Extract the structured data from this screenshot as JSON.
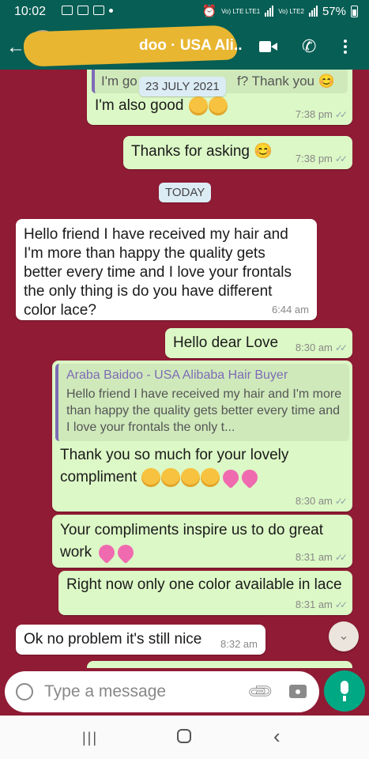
{
  "status_bar": {
    "time": "10:02",
    "lte_label_1": "Vo) LTE LTE1",
    "lte_label_2": "Vo) LTE2",
    "battery": "57%"
  },
  "header": {
    "contact_name_visible": "doo · USA Ali.."
  },
  "chat": {
    "quoted_partial": {
      "text_left": "I'm go",
      "text_right": "f? Thank you 😊"
    },
    "date_overlay": "23 JULY 2021",
    "today_label": "TODAY",
    "messages": [
      {
        "direction": "out",
        "text": "I'm also good",
        "emoji": [
          "🥰",
          "🥰"
        ],
        "time": "7:38 pm"
      },
      {
        "direction": "out",
        "text": "Thanks for asking 😊",
        "time": "7:38 pm"
      },
      {
        "direction": "in",
        "text": "Hello friend I have received my hair and I'm more than happy the quality gets better every time and I love your frontals the only thing is do you have different color lace?",
        "time": "6:44 am"
      },
      {
        "direction": "out",
        "text": "Hello dear Love",
        "time": "8:30 am"
      },
      {
        "direction": "out",
        "quote_name": "Araba Baidoo - USA Alibaba Hair Buyer",
        "quote_text": "Hello friend I have received my hair and I'm more than happy the quality gets better every time and I love your frontals the only t...",
        "text": "Thank you so much for your lovely compliment",
        "emoji": [
          "🥰",
          "🥰",
          "😍",
          "😍",
          "💖",
          "💖"
        ],
        "time": "8:30 am"
      },
      {
        "direction": "out",
        "text": "Your compliments inspire us to do great work",
        "emoji": [
          "💞",
          "💞"
        ],
        "time": "8:31 am"
      },
      {
        "direction": "out",
        "text": "Right now only one color available in lace",
        "time": "8:31 am"
      },
      {
        "direction": "in",
        "text": "Ok no problem it's still nice",
        "time": "8:32 am"
      }
    ]
  },
  "input": {
    "placeholder": "Type a message"
  },
  "icons": [
    "back-arrow-icon",
    "video-call-icon",
    "phone-icon",
    "menu-icon",
    "emoji-icon",
    "attach-icon",
    "camera-icon",
    "mic-icon",
    "scroll-down-icon",
    "recent-apps-icon",
    "home-icon",
    "back-nav-icon"
  ],
  "colors": {
    "header": "#075e54",
    "outgoing_bubble": "#dcf8c6",
    "incoming_bubble": "#ffffff",
    "chat_background": "#8f1b34",
    "mic_button": "#00a884"
  }
}
